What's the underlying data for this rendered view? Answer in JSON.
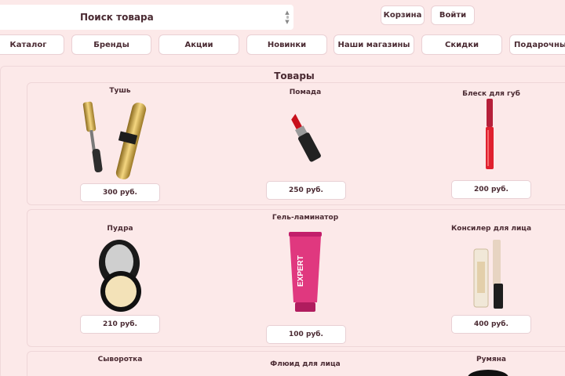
{
  "search": {
    "placeholder": "Поиск товара"
  },
  "header": {
    "cart_label": "Корзина",
    "login_label": "Войти"
  },
  "nav": [
    "Каталог",
    "Бренды",
    "Акции",
    "Новинки",
    "Наши магазины",
    "Скидки",
    "Подарочные наборы"
  ],
  "section": {
    "title": "Товары"
  },
  "products": [
    {
      "name": "Тушь",
      "price": "300 руб."
    },
    {
      "name": "Помада",
      "price": "250 руб."
    },
    {
      "name": "Блеск для губ",
      "price": "200 руб."
    },
    {
      "name": "Пудра",
      "price": "210 руб."
    },
    {
      "name": "Гель-ламинатор",
      "price": "100 руб."
    },
    {
      "name": "Консилер для лица",
      "price": "400 руб."
    },
    {
      "name": "Сыворотка"
    },
    {
      "name": "Флюид для лица"
    },
    {
      "name": "Румяна"
    }
  ],
  "colors": {
    "background": "#fce9e9",
    "text": "#4a2a32",
    "button": "#ffffff"
  },
  "icons": {
    "spinner": "number-spinner-icon"
  }
}
